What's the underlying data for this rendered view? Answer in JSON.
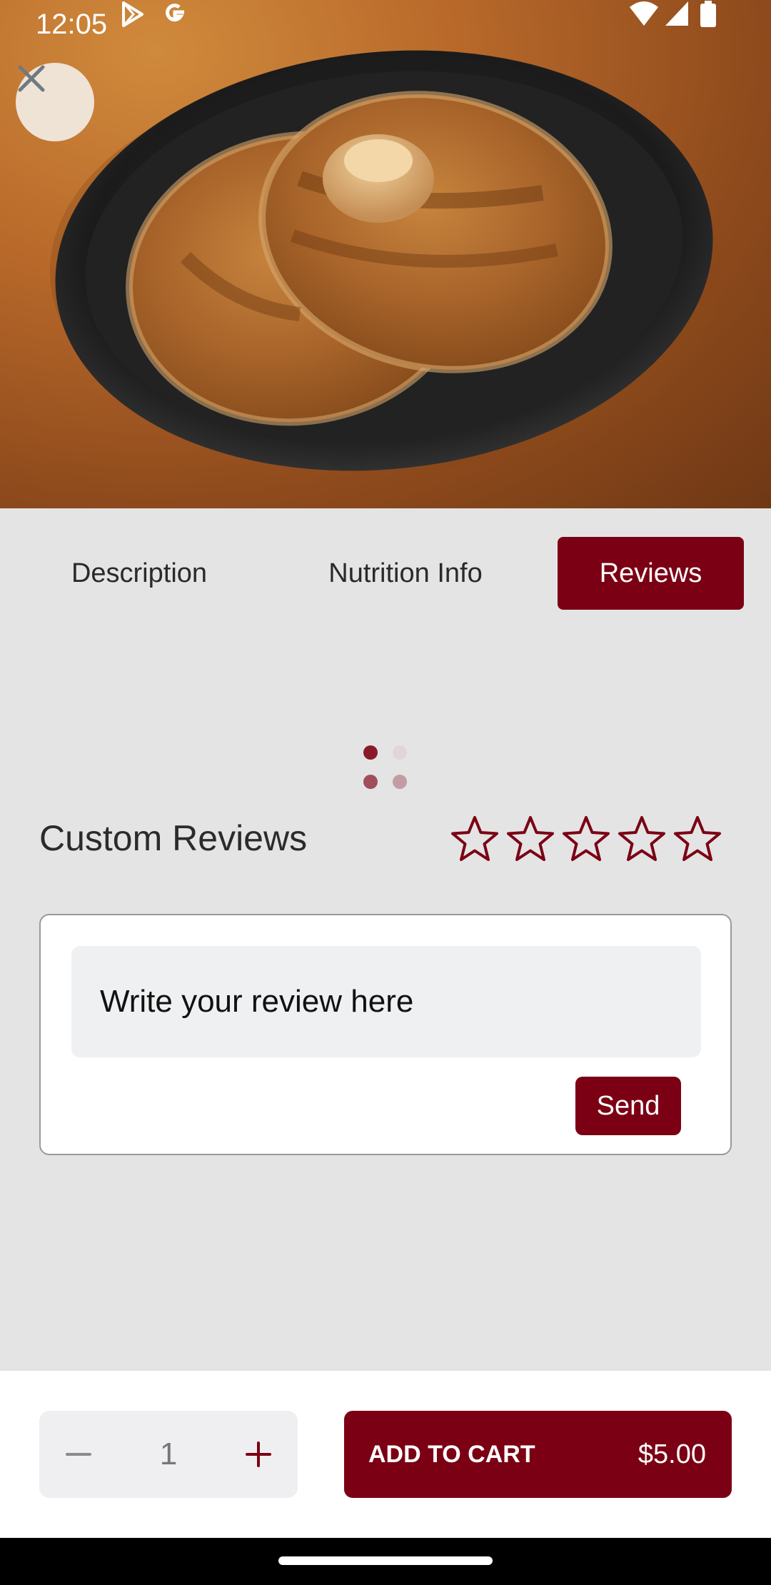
{
  "status_bar": {
    "time": "12:05"
  },
  "hero": {
    "alt": "pancakes",
    "icons": [
      "close-icon"
    ]
  },
  "tabs": [
    {
      "label": "Description",
      "active": false
    },
    {
      "label": "Nutrition Info",
      "active": false
    },
    {
      "label": "Reviews",
      "active": true
    }
  ],
  "reviews": {
    "title": "Custom Reviews",
    "rating": 0,
    "max_rating": 5,
    "input_placeholder": "Write your review here",
    "send_label": "Send"
  },
  "cart": {
    "quantity": "1",
    "add_label": "ADD TO CART",
    "price": "$5.00"
  },
  "colors": {
    "accent": "#7b0014",
    "page_bg": "#e4e4e4",
    "input_bg": "#eff0f2"
  }
}
